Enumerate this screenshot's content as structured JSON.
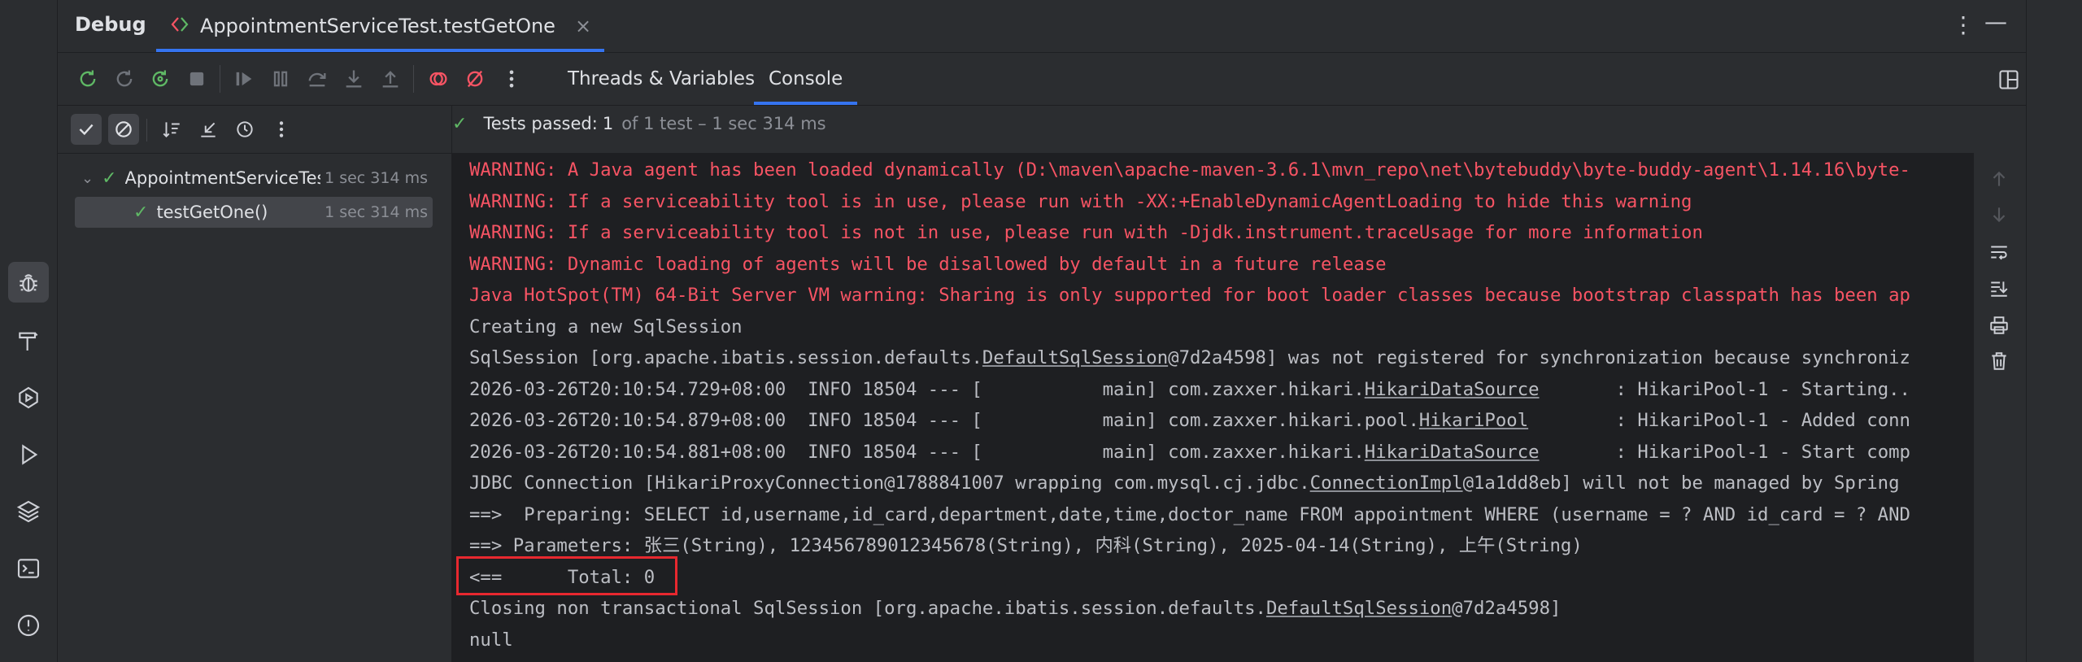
{
  "header": {
    "title": "Debug",
    "session_tab": "AppointmentServiceTest.testGetOne",
    "close_glyph": "×",
    "more_glyph": "⋮",
    "minimize_glyph": "—"
  },
  "view_tabs": [
    {
      "label": "Threads & Variables"
    },
    {
      "label": "Console",
      "selected": true
    }
  ],
  "status": {
    "check": "✓",
    "passed_label": "Tests passed:",
    "passed_count": "1",
    "detail": "of 1 test – 1 sec 314 ms"
  },
  "tree": [
    {
      "label": "AppointmentServiceTest",
      "duration": "1 sec 314 ms"
    },
    {
      "label": "testGetOne()",
      "duration": "1 sec 314 ms"
    }
  ],
  "console_lines": [
    {
      "text": "WARNING: A Java agent has been loaded dynamically (D:\\maven\\apache-maven-3.6.1\\mvn_repo\\net\\bytebuddy\\byte-buddy-agent\\1.14.16\\byte-",
      "type": "err"
    },
    {
      "text": "WARNING: If a serviceability tool is in use, please run with -XX:+EnableDynamicAgentLoading to hide this warning",
      "type": "err"
    },
    {
      "text": "WARNING: If a serviceability tool is not in use, please run with -Djdk.instrument.traceUsage for more information",
      "type": "err"
    },
    {
      "text": "WARNING: Dynamic loading of agents will be disallowed by default in a future release",
      "type": "err"
    },
    {
      "text": "Java HotSpot(TM) 64-Bit Server VM warning: Sharing is only supported for boot loader classes because bootstrap classpath has been ap",
      "type": "err"
    },
    {
      "text": "Creating a new SqlSession",
      "type": "out"
    },
    {
      "text": "SqlSession [org.apache.ibatis.session.defaults.DefaultSqlSession@7d2a4598] was not registered for synchronization because synchroniz",
      "type": "out"
    },
    {
      "text": "2026-03-26T20:10:54.729+08:00  INFO 18504 --- [           main] com.zaxxer.hikari.HikariDataSource       : HikariPool-1 - Starting..",
      "type": "out"
    },
    {
      "text": "2026-03-26T20:10:54.879+08:00  INFO 18504 --- [           main] com.zaxxer.hikari.pool.HikariPool        : HikariPool-1 - Added conn",
      "type": "out"
    },
    {
      "text": "2026-03-26T20:10:54.881+08:00  INFO 18504 --- [           main] com.zaxxer.hikari.HikariDataSource       : HikariPool-1 - Start comp",
      "type": "out"
    },
    {
      "text": "JDBC Connection [HikariProxyConnection@1788841007 wrapping com.mysql.cj.jdbc.ConnectionImpl@1a1dd8eb] will not be managed by Spring",
      "type": "out"
    },
    {
      "text": "==>  Preparing: SELECT id,username,id_card,department,date,time,doctor_name FROM appointment WHERE (username = ? AND id_card = ? AND",
      "type": "out"
    },
    {
      "text": "==> Parameters: 张三(String), 123456789012345678(String), 内科(String), 2025-04-14(String), 上午(String)",
      "type": "out"
    },
    {
      "text": "<==      Total: 0",
      "type": "out"
    },
    {
      "text": "Closing non transactional SqlSession [org.apache.ibatis.session.defaults.DefaultSqlSession@7d2a4598]",
      "type": "out"
    },
    {
      "text": "null",
      "type": "out"
    }
  ]
}
